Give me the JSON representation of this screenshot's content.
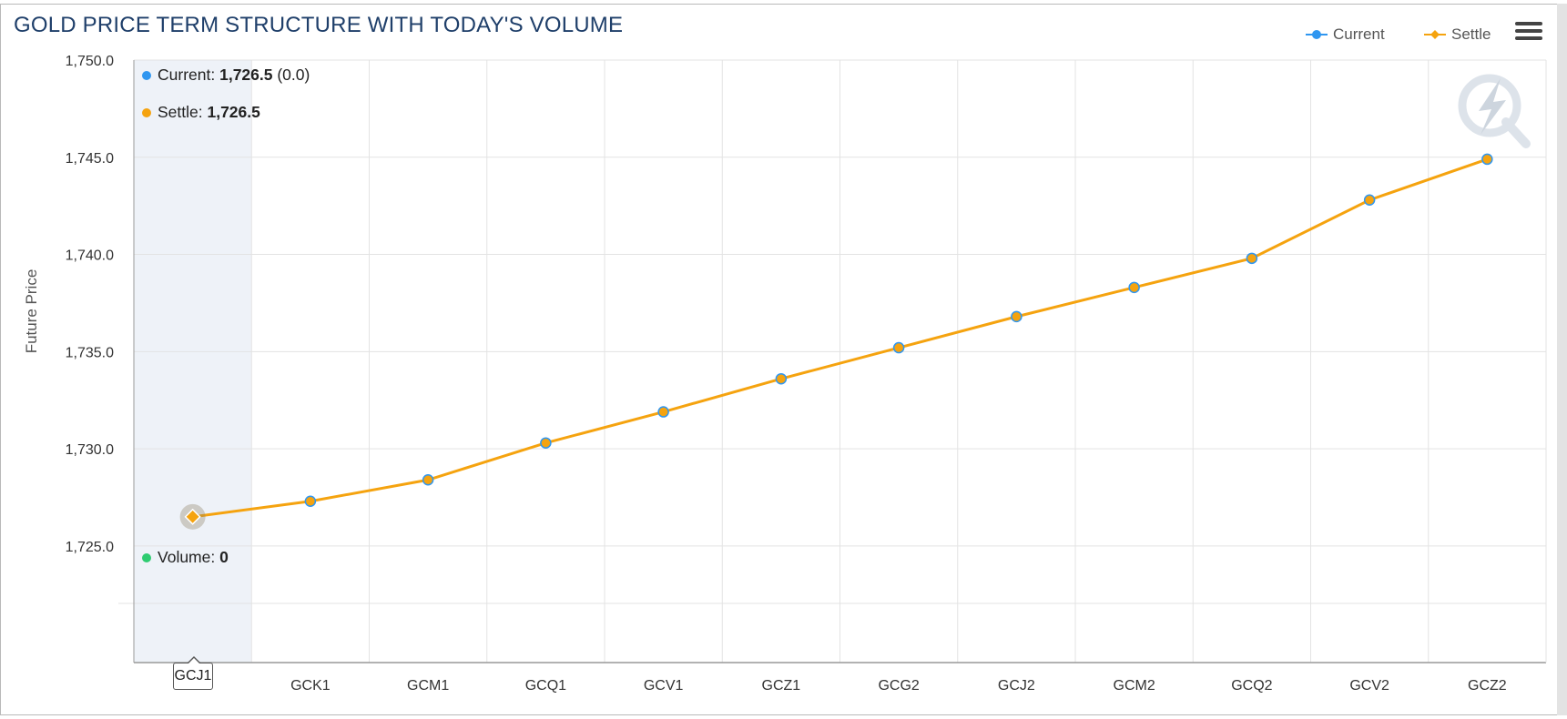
{
  "title": "GOLD PRICE TERM STRUCTURE WITH TODAY'S VOLUME",
  "legend": [
    {
      "name": "Current",
      "color": "#2f96f0",
      "marker": "circle"
    },
    {
      "name": "Settle",
      "color": "#f5a30f",
      "marker": "diamond"
    }
  ],
  "menu_icon": "hamburger-menu-icon",
  "watermark_icon": "lightning-q-logo",
  "tooltip": {
    "current_label": "Current",
    "current_value": "1,726.5",
    "current_change": "(0.0)",
    "settle_label": "Settle",
    "settle_value": "1,726.5",
    "volume_label": "Volume",
    "volume_value": "0",
    "category": "GCJ1",
    "volume_color": "#2ecc71"
  },
  "chart_data": {
    "type": "line",
    "title": "GOLD PRICE TERM STRUCTURE WITH TODAY'S VOLUME",
    "xlabel": "",
    "ylabel": "Future Price",
    "ylim": [
      1719,
      1750
    ],
    "yticks": [
      1725.0,
      1730.0,
      1735.0,
      1740.0,
      1745.0,
      1750.0
    ],
    "ytick_labels": [
      "1,725.0",
      "1,730.0",
      "1,735.0",
      "1,740.0",
      "1,745.0",
      "1,750.0"
    ],
    "categories": [
      "GCJ1",
      "GCK1",
      "GCM1",
      "GCQ1",
      "GCV1",
      "GCZ1",
      "GCG2",
      "GCJ2",
      "GCM2",
      "GCQ2",
      "GCV2",
      "GCZ2"
    ],
    "series": [
      {
        "name": "Current",
        "color": "#2f96f0",
        "values": [
          1726.5,
          1727.3,
          1728.4,
          1730.3,
          1731.9,
          1733.6,
          1735.2,
          1736.8,
          1738.3,
          1739.8,
          1742.8,
          1744.9
        ]
      },
      {
        "name": "Settle",
        "color": "#f5a30f",
        "values": [
          1726.5,
          1727.3,
          1728.4,
          1730.3,
          1731.9,
          1733.6,
          1735.2,
          1736.8,
          1738.3,
          1739.8,
          1742.8,
          1744.9
        ]
      }
    ],
    "highlighted_category": "GCJ1",
    "grid": true,
    "legend_position": "top-right"
  }
}
